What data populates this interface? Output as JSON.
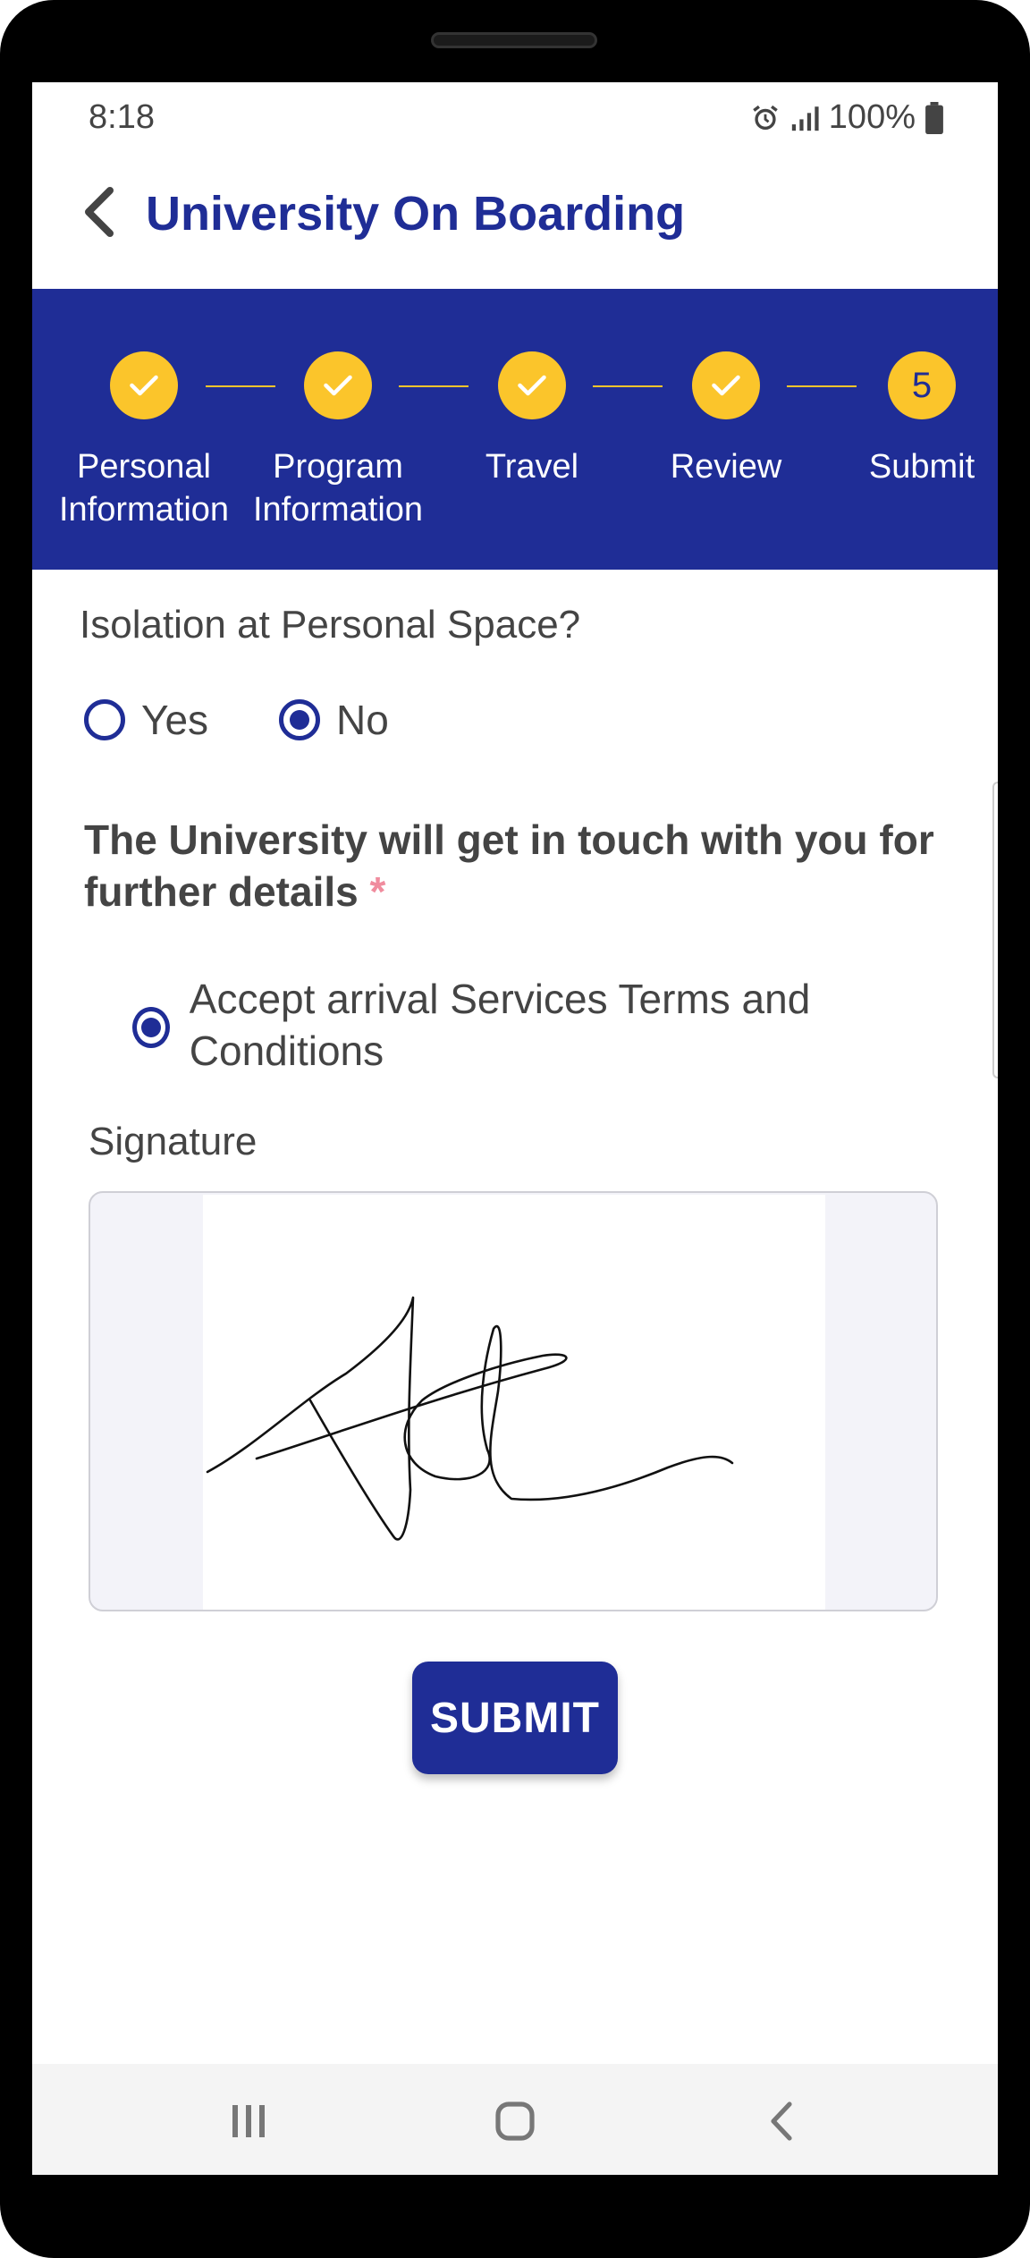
{
  "status_bar": {
    "time": "8:18",
    "battery": "100%"
  },
  "app_bar": {
    "title": "University On Boarding"
  },
  "stepper": {
    "current_step": "5",
    "steps": [
      {
        "label_line1": "Personal",
        "label_line2": "Information",
        "state": "done"
      },
      {
        "label_line1": "Program",
        "label_line2": "Information",
        "state": "done"
      },
      {
        "label_line1": "Travel",
        "label_line2": "",
        "state": "done"
      },
      {
        "label_line1": "Review",
        "label_line2": "",
        "state": "done"
      },
      {
        "label_line1": "Submit",
        "label_line2": "",
        "state": "current"
      }
    ]
  },
  "isolation": {
    "question": "Isolation at Personal Space?",
    "options": [
      "Yes",
      "No"
    ],
    "selected": "No"
  },
  "contact_notice": {
    "text": "The University will get in touch with you for further details",
    "required_mark": "*"
  },
  "terms": {
    "label": "Accept arrival Services Terms and Conditions",
    "selected": true
  },
  "signature": {
    "label": "Signature"
  },
  "submit": {
    "label": "SUBMIT"
  },
  "colors": {
    "brand": "#1f2d96",
    "accent": "#fbc52b",
    "text": "#444444",
    "required": "#f08c9e"
  }
}
